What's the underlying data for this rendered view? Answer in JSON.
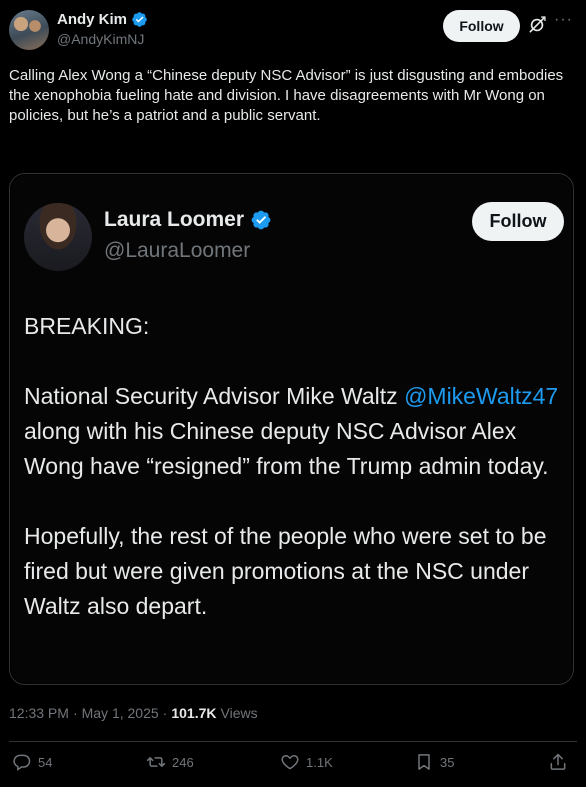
{
  "author": {
    "name": "Andy Kim",
    "handle": "@AndyKimNJ",
    "follow_label": "Follow"
  },
  "tweet": {
    "text": "Calling Alex Wong a “Chinese deputy NSC Advisor” is just disgusting and embodies the xenophobia fueling hate and division. I have disagreements with Mr Wong on policies, but he’s a patriot and a public servant."
  },
  "quoted": {
    "name": "Laura Loomer",
    "handle": "@LauraLoomer",
    "follow_label": "Follow",
    "para1": "BREAKING:",
    "para2_pre": "National Security Advisor Mike Waltz ",
    "para2_mention": "@MikeWaltz47",
    "para2_post": " along with his Chinese deputy NSC Advisor Alex Wong have “resigned” from the Trump admin today.",
    "para3": "Hopefully, the rest of the people who were set to be fired but were given promotions at the NSC under Waltz also depart."
  },
  "meta": {
    "time": "12:33 PM",
    "sep1": "·",
    "date": "May 1, 2025",
    "sep2": "·",
    "views_count": "101.7K",
    "views_label": "Views"
  },
  "actions": {
    "replies": "54",
    "reposts": "246",
    "likes": "1.1K",
    "bookmarks": "35"
  },
  "colors": {
    "background": "#000000",
    "text": "#e7e9ea",
    "muted": "#71767b",
    "accent": "#1d9bf0",
    "border": "#2f3336"
  },
  "icons": [
    "verified-badge-icon",
    "grok-icon",
    "more-icon",
    "reply-icon",
    "repost-icon",
    "like-icon",
    "bookmark-icon",
    "share-icon"
  ]
}
